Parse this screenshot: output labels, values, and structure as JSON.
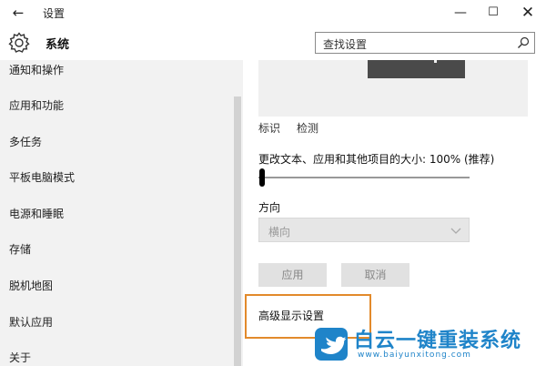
{
  "window": {
    "back_glyph": "←",
    "title": "设置",
    "minimize_glyph": "—",
    "maximize_glyph": "☐",
    "close_glyph": "✕"
  },
  "header": {
    "icon": "gear-icon",
    "section_title": "系统",
    "search_placeholder": "查找设置",
    "search_icon": "search-icon"
  },
  "sidebar": {
    "items": [
      {
        "label": "通知和操作"
      },
      {
        "label": "应用和功能"
      },
      {
        "label": "多任务"
      },
      {
        "label": "平板电脑模式"
      },
      {
        "label": "电源和睡眠"
      },
      {
        "label": "存储"
      },
      {
        "label": "脱机地图"
      },
      {
        "label": "默认应用"
      },
      {
        "label": "关于"
      }
    ]
  },
  "main": {
    "identify_label": "标识",
    "detect_label": "检测",
    "scale_label": "更改文本、应用和其他项目的大小: 100% (推荐)",
    "scale_slider_value": 0,
    "orientation_label": "方向",
    "orientation_value": "横向",
    "apply_label": "应用",
    "cancel_label": "取消",
    "advanced_label": "高级显示设置"
  },
  "watermark": {
    "icon": "bird-logo-icon",
    "title": "白云一键重装系统",
    "url": "www.baiyunxitong.com"
  },
  "colors": {
    "sidebar_bg": "#f2f2f2",
    "highlight_border": "#e28a2b",
    "watermark_blue": "#1f84c9",
    "button_bg": "#e1e1e1"
  }
}
